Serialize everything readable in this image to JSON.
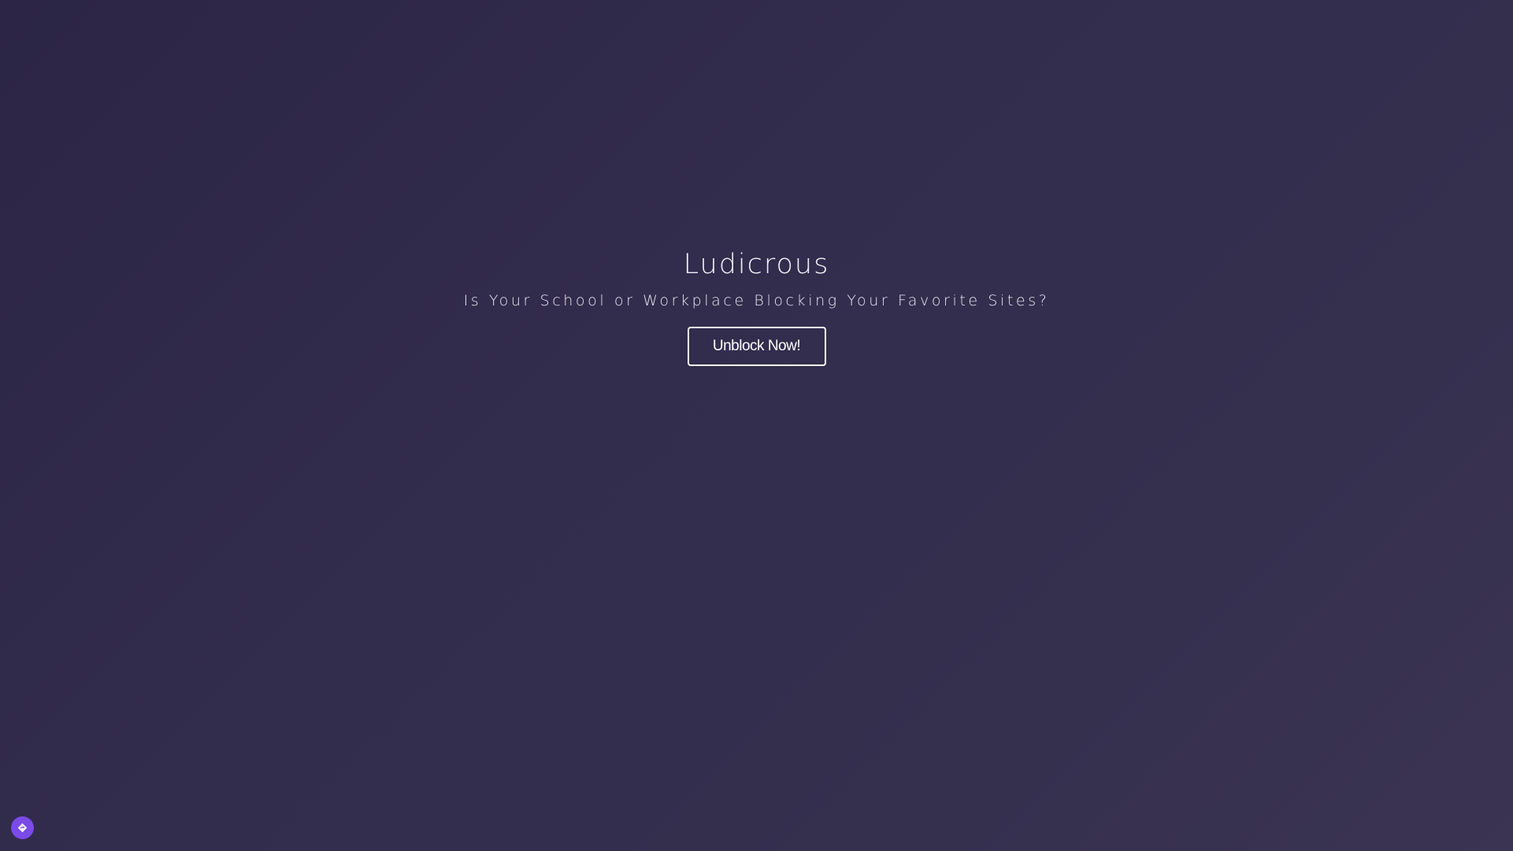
{
  "hero": {
    "title": "Ludicrous",
    "subtitle": "Is Your School or Workplace Blocking Your Favorite Sites?",
    "button_label": "Unblock Now!"
  },
  "floating_button": {
    "icon": "diamond-arrow-icon",
    "color": "#7a4be6"
  },
  "colors": {
    "background_start": "#2c2545",
    "background_end": "#3b3553",
    "text": "#ffffff"
  }
}
